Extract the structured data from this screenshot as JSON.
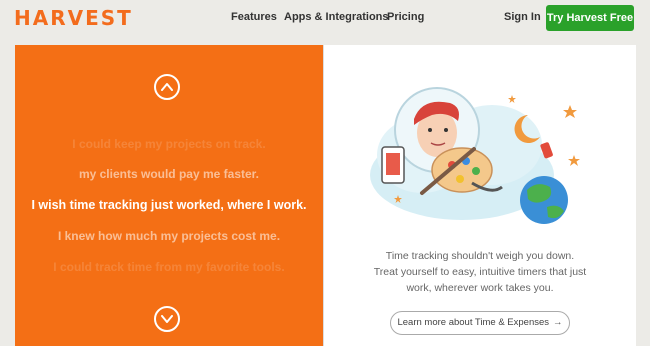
{
  "header": {
    "logo": "HARVEST",
    "nav": [
      "Features",
      "Apps & Integrations",
      "Pricing"
    ],
    "signin": "Sign In",
    "cta": "Try Harvest Free"
  },
  "hero": {
    "slogans": [
      "I could keep my projects on track.",
      "my clients would pay me faster.",
      "I wish time tracking just worked, where I work.",
      "I knew how much my projects cost me.",
      "I could track time from my favorite tools."
    ],
    "active_index": 2
  },
  "info": {
    "description_lines": [
      "Time tracking shouldn't weigh you down.",
      "Treat yourself to easy, intuitive timers that just",
      "work, wherever work takes you."
    ],
    "learn_more": "Learn more about Time & Expenses",
    "learn_more_arrow": "→"
  },
  "colors": {
    "brand": "#f36c1d",
    "panel": "#f46f15",
    "cta": "#2aa12a"
  },
  "icons": [
    "chevron-up-icon",
    "chevron-down-icon",
    "arrow-right-icon"
  ]
}
